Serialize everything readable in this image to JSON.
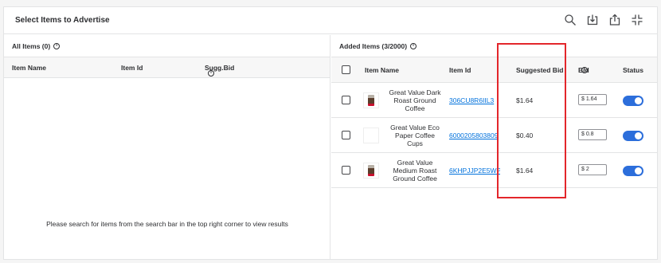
{
  "header": {
    "title": "Select Items to Advertise"
  },
  "icons": {
    "search": "search-icon",
    "download": "download-icon",
    "share": "upload-icon",
    "collapse": "collapse-icon"
  },
  "left_panel": {
    "title": "All Items (0)",
    "columns": [
      "Item Name",
      "Item Id",
      "Sugg.Bid"
    ],
    "empty_message": "Please search for items from the search bar in the top right corner to view results"
  },
  "right_panel": {
    "title": "Added Items (3/2000)",
    "columns": {
      "name": "Item Name",
      "id": "Item Id",
      "suggested": "Suggested Bid",
      "bid": "Bid",
      "status": "Status"
    },
    "rows": [
      {
        "name": "Great Value Dark Roast Ground Coffee",
        "id": "306CU8R6IIL3",
        "suggested_bid": "$1.64",
        "bid": "$ 1.64",
        "has_image": true,
        "enabled": true
      },
      {
        "name": "Great Value Eco Paper Coffee Cups",
        "id": "6000205803809",
        "suggested_bid": "$0.40",
        "bid": "$ 0.8",
        "has_image": false,
        "enabled": true
      },
      {
        "name": "Great Value Medium Roast Ground Coffee",
        "id": "6KHPJJP2E5WP",
        "suggested_bid": "$1.64",
        "bid": "$ 2",
        "has_image": true,
        "enabled": true
      }
    ]
  },
  "colors": {
    "toggle_on": "#2c6edb",
    "link": "#0071dc",
    "highlight": "#e3262b"
  }
}
